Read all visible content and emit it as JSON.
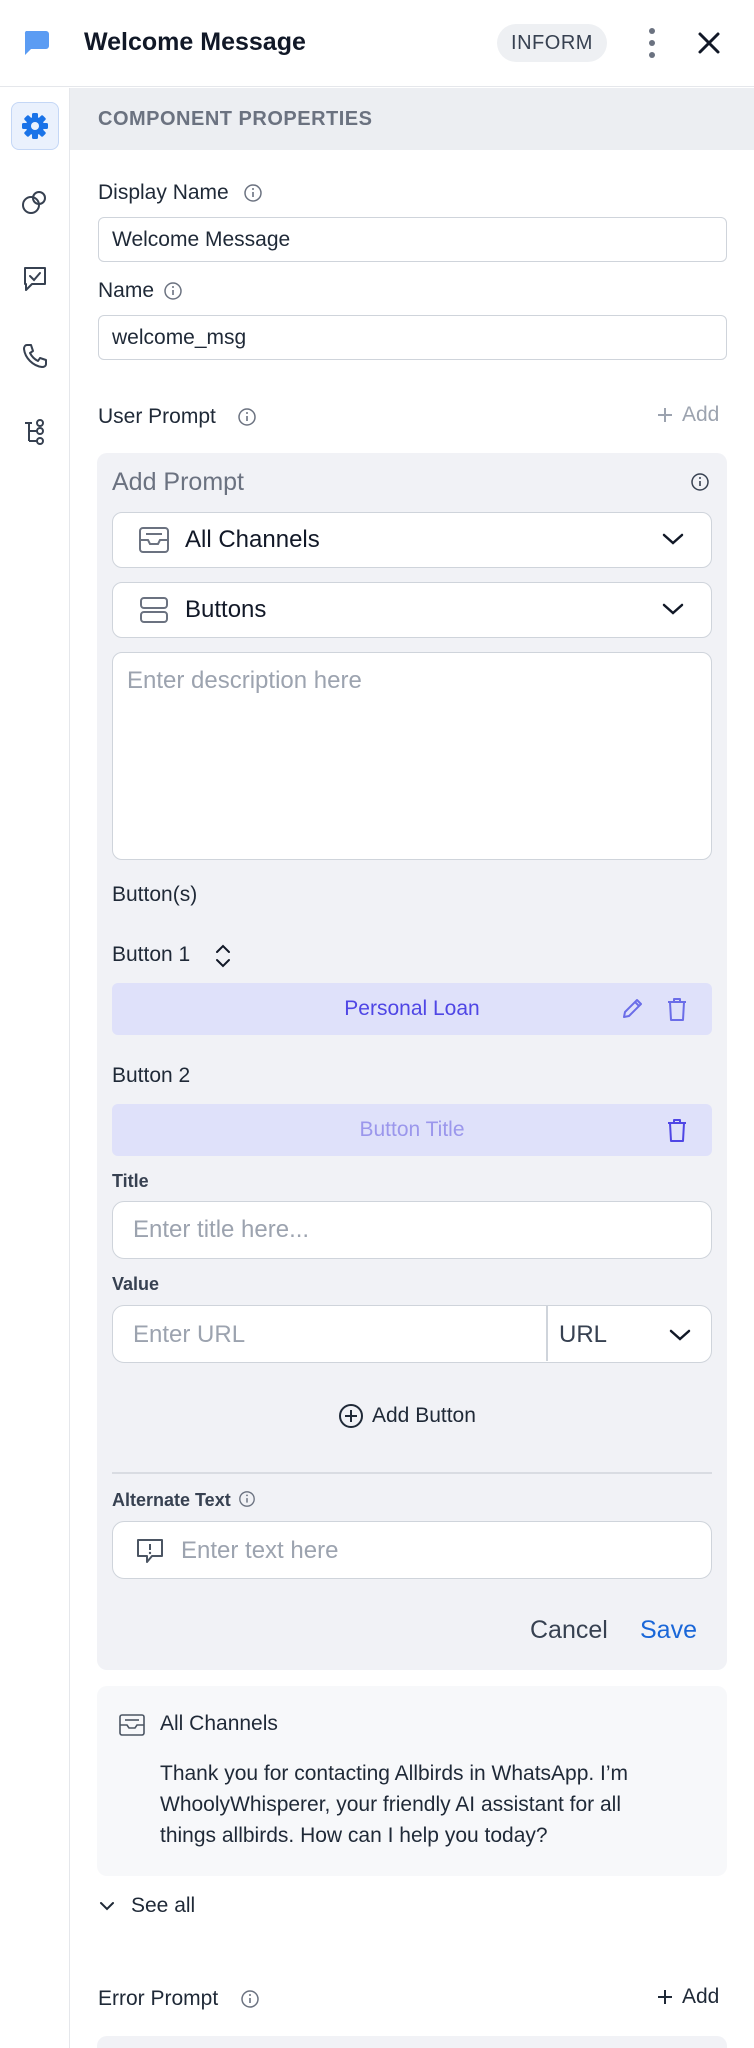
{
  "header": {
    "title": "Welcome Message",
    "badge": "INFORM"
  },
  "colors": {
    "accent": "#1a67d8",
    "rail_active_bg": "#eaf1fd",
    "button_bar": "#dfe1fa",
    "button_text": "#4f46e5"
  },
  "rail": {
    "items": [
      {
        "icon": "gear-icon",
        "active": true
      },
      {
        "icon": "link-circles-icon",
        "active": false
      },
      {
        "icon": "chat-check-icon",
        "active": false
      },
      {
        "icon": "phone-icon",
        "active": false
      },
      {
        "icon": "flow-tree-icon",
        "active": false
      }
    ]
  },
  "section": {
    "title": "COMPONENT PROPERTIES"
  },
  "display_name": {
    "label": "Display Name",
    "value": "Welcome Message"
  },
  "name": {
    "label": "Name",
    "value": "welcome_msg"
  },
  "user_prompt": {
    "label": "User Prompt",
    "add_label": "Add"
  },
  "prompt_editor": {
    "title": "Add Prompt",
    "channel_dropdown": "All Channels",
    "type_dropdown": "Buttons",
    "description_placeholder": "Enter description here",
    "buttons_heading": "Button(s)",
    "button1": {
      "label": "Button 1",
      "title": "Personal Loan"
    },
    "button2": {
      "label": "Button 2",
      "title_placeholder": "Button Title"
    },
    "title_field": {
      "label": "Title",
      "placeholder": "Enter title here..."
    },
    "value_field": {
      "label": "Value",
      "placeholder": "Enter URL",
      "type": "URL"
    },
    "add_button_label": "Add Button",
    "alternate_text": {
      "label": "Alternate Text",
      "placeholder": "Enter text here"
    },
    "cancel_label": "Cancel",
    "save_label": "Save"
  },
  "preview": {
    "channel": "All Channels",
    "message": "Thank you for contacting Allbirds in WhatsApp. I’m WhoolyWhisperer, your friendly AI assistant for all things allbirds. How can I help you today?"
  },
  "see_all_label": "See all",
  "error_prompt": {
    "label": "Error Prompt",
    "add_label": "Add"
  }
}
